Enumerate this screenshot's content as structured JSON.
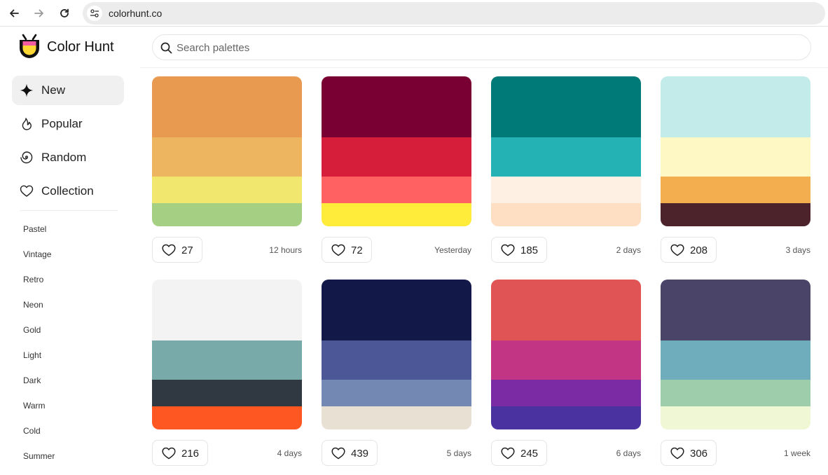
{
  "browser": {
    "url": "colorhunt.co"
  },
  "header": {
    "brand": "Color Hunt",
    "search_placeholder": "Search palettes"
  },
  "sidebar": {
    "nav": [
      {
        "label": "New",
        "icon": "sparkle-icon",
        "active": true
      },
      {
        "label": "Popular",
        "icon": "flame-icon",
        "active": false
      },
      {
        "label": "Random",
        "icon": "spiral-icon",
        "active": false
      },
      {
        "label": "Collection",
        "icon": "heart-icon",
        "active": false
      }
    ],
    "tags": [
      "Pastel",
      "Vintage",
      "Retro",
      "Neon",
      "Gold",
      "Light",
      "Dark",
      "Warm",
      "Cold",
      "Summer"
    ]
  },
  "palettes": [
    {
      "colors": [
        "#E89B50",
        "#EEB560",
        "#F1E66E",
        "#A5D083"
      ],
      "likes": "27",
      "time": "12 hours"
    },
    {
      "colors": [
        "#780032",
        "#D61D3A",
        "#FF6162",
        "#FEEB3A"
      ],
      "likes": "72",
      "time": "Yesterday"
    },
    {
      "colors": [
        "#007A78",
        "#24B2B4",
        "#FFF0E4",
        "#FFDFC3"
      ],
      "likes": "185",
      "time": "2 days"
    },
    {
      "colors": [
        "#C2EBE9",
        "#FEF8C5",
        "#F3AE50",
        "#4D232B"
      ],
      "likes": "208",
      "time": "3 days"
    },
    {
      "colors": [
        "#F3F3F3",
        "#78AAAA",
        "#303841",
        "#FF5722"
      ],
      "likes": "216",
      "time": "4 days"
    },
    {
      "colors": [
        "#121949",
        "#4C5797",
        "#7488B4",
        "#E8E0D2"
      ],
      "likes": "439",
      "time": "5 days"
    },
    {
      "colors": [
        "#E05455",
        "#C23584",
        "#7B2BA3",
        "#4A33A0"
      ],
      "likes": "245",
      "time": "6 days"
    },
    {
      "colors": [
        "#4A4468",
        "#6FADBD",
        "#9ECDAC",
        "#EFF7D4"
      ],
      "likes": "306",
      "time": "1 week"
    }
  ]
}
